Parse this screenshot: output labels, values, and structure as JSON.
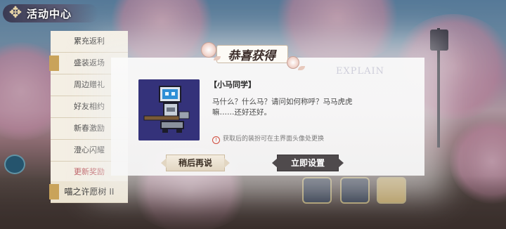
{
  "header": {
    "title": "活动中心",
    "emblem_icon": "compass-emblem-icon"
  },
  "menu": {
    "items": [
      {
        "label": "累充返利"
      },
      {
        "label": "盛装返场"
      },
      {
        "label": "周边赠礼"
      },
      {
        "label": "好友相约"
      },
      {
        "label": "新春激励"
      },
      {
        "label": "澄心闪耀"
      },
      {
        "label": "更新奖励"
      },
      {
        "label": "喵之许愿树 II"
      }
    ]
  },
  "dialog": {
    "title": "恭喜获得",
    "watermark": "EXPLAIN",
    "item_name": "【小马同学】",
    "description": "马什么？什么马？请问如何称呼？马马虎虎嘛……还好还好。",
    "hint": "获取后的装扮可在主界面头像处更换",
    "later_button": "稍后再说",
    "confirm_button": "立即设置"
  },
  "colors": {
    "confirm_bg": "#4f4a4c",
    "later_bg": "#e9dfcc",
    "avatar_bg": "#34327a",
    "warn": "#d04b3c"
  }
}
